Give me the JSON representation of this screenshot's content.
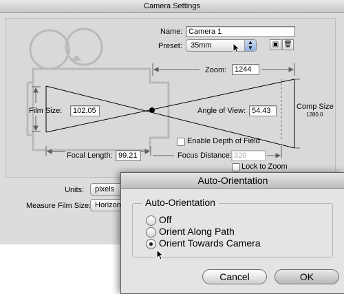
{
  "window": {
    "title": "Camera Settings"
  },
  "name": {
    "label": "Name:",
    "value": "Camera 1"
  },
  "preset": {
    "label": "Preset:",
    "value": "35mm"
  },
  "zoom": {
    "label": "Zoom:",
    "value": "1244"
  },
  "film_size": {
    "label": "Film Size:",
    "value": "102.05"
  },
  "angle_of_view": {
    "label": "Angle of View:",
    "value": "54.43"
  },
  "comp_size": {
    "label": "Comp Size",
    "value": "1280.0"
  },
  "depth_of_field": {
    "label": "Enable Depth of Field",
    "checked": false
  },
  "focal_length": {
    "label": "Focal Length:",
    "value": "99.21"
  },
  "focus_distance": {
    "label": "Focus Distance:",
    "value": "320"
  },
  "lock_to_zoom": {
    "label": "Lock to Zoom",
    "checked": false
  },
  "units": {
    "label": "Units:",
    "value": "pixels"
  },
  "measure_film_size": {
    "label": "Measure Film Size:",
    "value": "Horizonta"
  },
  "icons": {
    "save": "save-icon",
    "delete": "trash-icon"
  },
  "dialog": {
    "title": "Auto-Orientation",
    "group_title": "Auto-Orientation",
    "options": [
      {
        "label": "Off",
        "selected": false
      },
      {
        "label": "Orient Along Path",
        "selected": false
      },
      {
        "label": "Orient Towards Camera",
        "selected": true
      }
    ],
    "cancel_label": "Cancel",
    "ok_label": "OK"
  }
}
